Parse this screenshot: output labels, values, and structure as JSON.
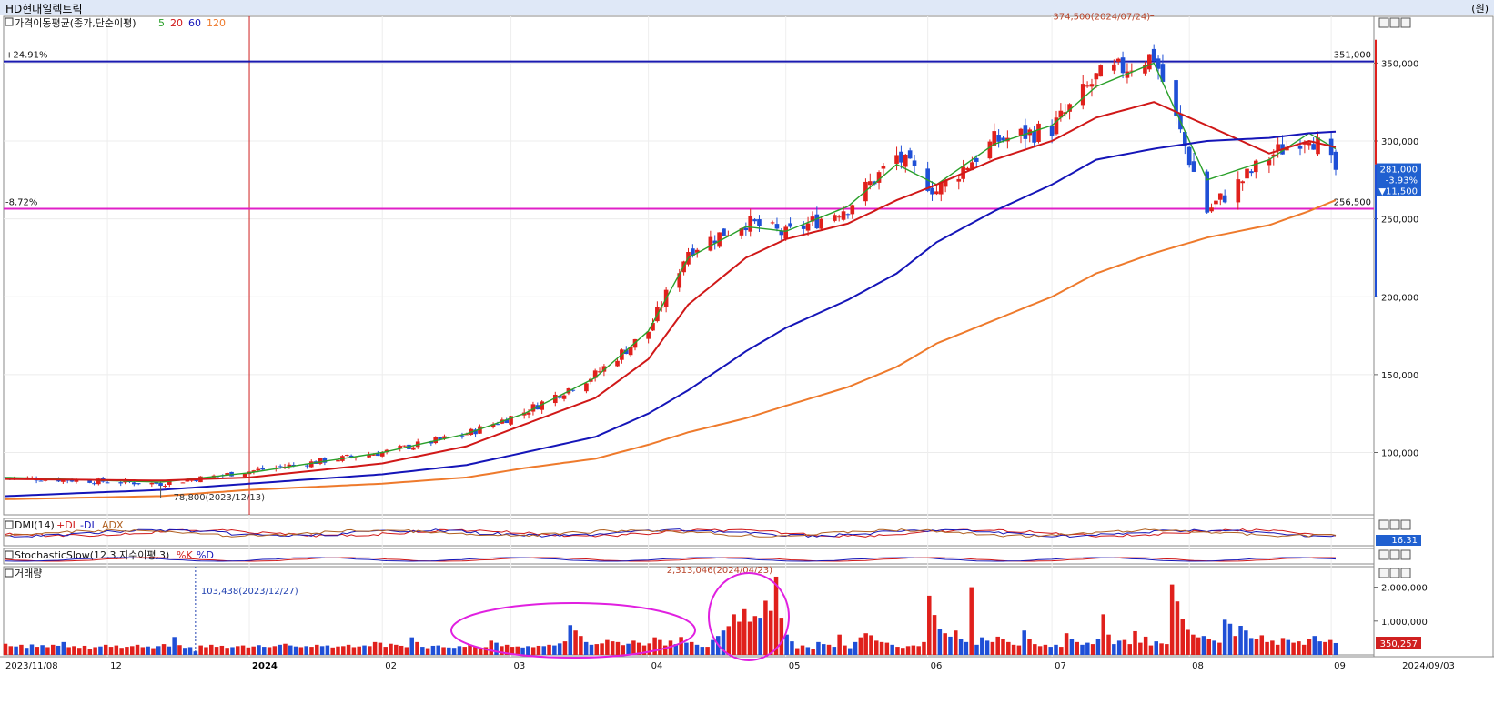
{
  "window": {
    "title": "HD현대일렉트릭",
    "unit": "(원)"
  },
  "price_panel": {
    "indicator_label": "가격이동평균(종가,단순이평)",
    "ma_labels": [
      "5",
      "20",
      "60",
      "120"
    ],
    "high_annotation": "374,500(2024/07/24)",
    "low_annotation": "78,800(2023/12/13)",
    "upper_line_pct": "+24.91%",
    "lower_line_pct": "-8.72%",
    "upper_line_value": "351,000",
    "lower_line_value": "256,500",
    "last_price": "281,000",
    "change_pct": "-3.93%",
    "change_amt": "▼11,500",
    "y_ticks": [
      "350,000",
      "300,000",
      "250,000",
      "200,000",
      "150,000",
      "100,000"
    ]
  },
  "dmi_panel": {
    "label": "DMI(14)",
    "plus": "+DI",
    "minus": "-DI",
    "adx": "ADX",
    "value": "16.31"
  },
  "stoch_panel": {
    "label": "StochasticSlow(12,3,지수이평,3)",
    "k": "%K",
    "d": "%D"
  },
  "volume_panel": {
    "label": "거래량",
    "peak_annotation": "2,313,046(2024/04/23)",
    "low_annotation": "103,438(2023/12/27)",
    "last_volume": "350,257",
    "y_ticks": [
      "2,000,000",
      "1,000,000"
    ]
  },
  "x_axis": {
    "labels": [
      "2023/11/08",
      "12",
      "2024",
      "02",
      "03",
      "04",
      "05",
      "06",
      "07",
      "08",
      "09",
      "2024/09/03"
    ]
  },
  "colors": {
    "up": "#e0201c",
    "down": "#1f4fd6",
    "ma5": "#2aa02a",
    "ma20": "#d01818",
    "ma60": "#1515b8",
    "ma120": "#ee7a2c",
    "hline_upper": "#1a1ab0",
    "hline_lower": "#e020c8",
    "highlight": "#e020e0"
  },
  "chart_data": [
    {
      "type": "candlestick",
      "title": "HD현대일렉트릭",
      "x_start": "2023/11/08",
      "x_end": "2024/09/03",
      "ylim": [
        60000,
        380000
      ],
      "close_path": [
        {
          "date": "2023/11/08",
          "close": 84000
        },
        {
          "date": "2023/12/13",
          "close": 80000
        },
        {
          "date": "2024/01/02",
          "close": 88000
        },
        {
          "date": "2024/02/01",
          "close": 100000
        },
        {
          "date": "2024/02/20",
          "close": 112000
        },
        {
          "date": "2024/03/04",
          "close": 126000
        },
        {
          "date": "2024/03/20",
          "close": 150000
        },
        {
          "date": "2024/04/01",
          "close": 178000
        },
        {
          "date": "2024/04/10",
          "close": 230000
        },
        {
          "date": "2024/04/23",
          "close": 248000
        },
        {
          "date": "2024/05/02",
          "close": 240000
        },
        {
          "date": "2024/05/16",
          "close": 258000
        },
        {
          "date": "2024/05/27",
          "close": 290000
        },
        {
          "date": "2024/06/05",
          "close": 268000
        },
        {
          "date": "2024/06/18",
          "close": 300000
        },
        {
          "date": "2024/07/01",
          "close": 308000
        },
        {
          "date": "2024/07/11",
          "close": 340000
        },
        {
          "date": "2024/07/24",
          "close": 355000
        },
        {
          "date": "2024/08/05",
          "close": 255000
        },
        {
          "date": "2024/08/19",
          "close": 290000
        },
        {
          "date": "2024/08/28",
          "close": 305000
        },
        {
          "date": "2024/09/03",
          "close": 281000
        }
      ],
      "high": {
        "date": "2024/07/24",
        "value": 374500
      },
      "low": {
        "date": "2023/12/13",
        "value": 78800
      },
      "moving_averages": [
        {
          "name": "5",
          "path": [
            84000,
            81000,
            87000,
            100000,
            112000,
            125000,
            148000,
            178000,
            225000,
            245000,
            242000,
            258000,
            285000,
            272000,
            298000,
            310000,
            335000,
            350000,
            275000,
            288000,
            305000,
            295000
          ]
        },
        {
          "name": "20",
          "path": [
            83000,
            82000,
            84000,
            93000,
            104000,
            118000,
            135000,
            160000,
            195000,
            225000,
            237000,
            247000,
            262000,
            272000,
            288000,
            300000,
            315000,
            325000,
            310000,
            292000,
            300000,
            296000
          ]
        },
        {
          "name": "60",
          "path": [
            72000,
            76000,
            80000,
            86000,
            92000,
            100000,
            110000,
            125000,
            140000,
            165000,
            180000,
            198000,
            215000,
            235000,
            255000,
            272000,
            288000,
            295000,
            300000,
            302000,
            305000,
            306000
          ]
        },
        {
          "name": "120",
          "path": [
            70000,
            72000,
            76000,
            80000,
            84000,
            90000,
            96000,
            105000,
            113000,
            122000,
            130000,
            142000,
            155000,
            170000,
            185000,
            200000,
            215000,
            228000,
            238000,
            246000,
            255000,
            262000
          ]
        }
      ]
    },
    {
      "type": "bar",
      "title": "거래량",
      "ylim": [
        0,
        2500000
      ],
      "x_start": "2023/11/08",
      "x_end": "2024/09/03",
      "values": [
        330000,
        260000,
        250000,
        300000,
        210000,
        310000,
        240000,
        290000,
        230000,
        300000,
        270000,
        380000,
        230000,
        260000,
        210000,
        270000,
        180000,
        230000,
        250000,
        300000,
        240000,
        280000,
        210000,
        240000,
        260000,
        300000,
        230000,
        250000,
        200000,
        260000,
        320000,
        250000,
        530000,
        290000,
        210000,
        230000,
        103438,
        280000,
        230000,
        300000,
        240000,
        270000,
        210000,
        230000,
        260000,
        280000,
        220000,
        250000,
        290000,
        240000,
        230000,
        260000,
        300000,
        330000,
        280000,
        250000,
        230000,
        260000,
        240000,
        300000,
        260000,
        280000,
        220000,
        250000,
        260000,
        300000,
        230000,
        250000,
        280000,
        260000,
        380000,
        360000,
        240000,
        330000,
        300000,
        270000,
        230000,
        520000,
        380000,
        240000,
        200000,
        270000,
        280000,
        230000,
        220000,
        210000,
        260000,
        240000,
        300000,
        240000,
        210000,
        230000,
        420000,
        360000,
        260000,
        300000,
        240000,
        250000,
        220000,
        260000,
        230000,
        270000,
        260000,
        300000,
        280000,
        340000,
        400000,
        880000,
        720000,
        560000,
        380000,
        300000,
        320000,
        340000,
        440000,
        400000,
        380000,
        290000,
        330000,
        420000,
        360000,
        280000,
        340000,
        520000,
        440000,
        280000,
        420000,
        320000,
        530000,
        360000,
        380000,
        300000,
        240000,
        240000,
        440000,
        560000,
        720000,
        850000,
        1200000,
        980000,
        1350000,
        980000,
        1150000,
        1100000,
        1600000,
        1300000,
        2313046,
        1100000,
        600000,
        400000,
        200000,
        280000,
        230000,
        180000,
        380000,
        320000,
        300000,
        240000,
        600000,
        280000,
        200000,
        380000,
        520000,
        640000,
        580000,
        420000,
        380000,
        360000,
        300000,
        240000,
        210000,
        260000,
        280000,
        260000,
        380000,
        1750000,
        1180000,
        760000,
        640000,
        540000,
        720000,
        460000,
        380000,
        2000000,
        300000,
        520000,
        420000,
        380000,
        540000,
        460000,
        380000,
        300000,
        280000,
        720000,
        460000,
        320000,
        260000,
        300000,
        240000,
        300000,
        240000,
        640000,
        480000,
        380000,
        300000,
        360000,
        320000,
        460000,
        1200000,
        600000,
        320000,
        420000,
        440000,
        320000,
        700000,
        360000,
        540000,
        280000,
        400000,
        340000,
        320000,
        2080000,
        1580000,
        1060000,
        740000,
        600000,
        520000,
        560000,
        460000,
        420000,
        360000,
        1040000,
        920000,
        560000,
        860000,
        720000,
        500000,
        460000,
        580000,
        380000,
        420000,
        300000,
        500000,
        440000,
        360000,
        400000,
        300000,
        480000,
        560000,
        400000,
        380000,
        440000,
        350257
      ]
    }
  ]
}
